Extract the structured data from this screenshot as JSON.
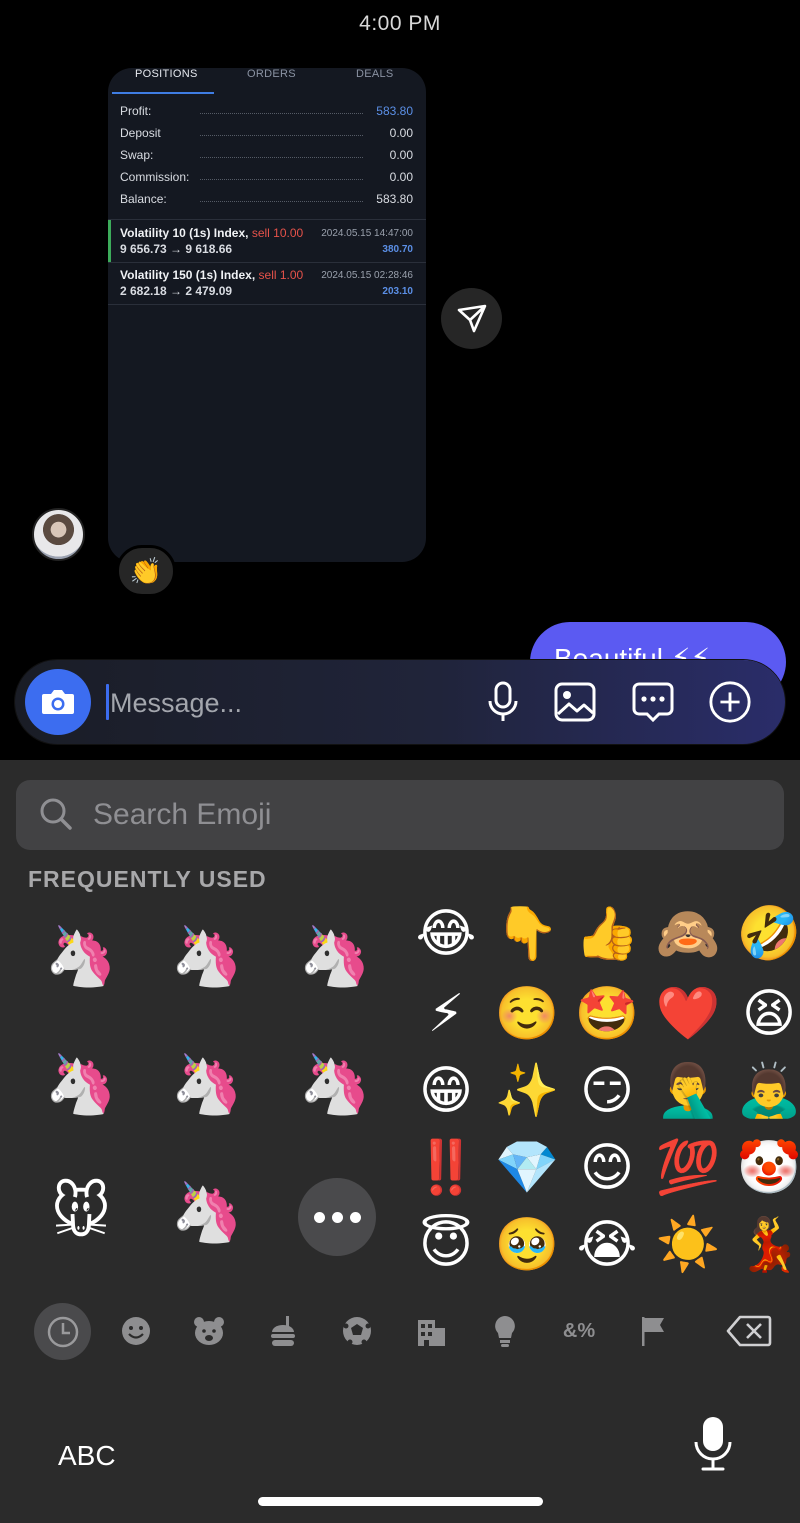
{
  "status": {
    "time": "4:00 PM"
  },
  "shared_card": {
    "tabs": [
      "POSITIONS",
      "ORDERS",
      "DEALS"
    ],
    "summary": [
      {
        "label": "Profit:",
        "value": "583.80"
      },
      {
        "label": "Deposit",
        "value": "0.00"
      },
      {
        "label": "Swap:",
        "value": "0.00"
      },
      {
        "label": "Commission:",
        "value": "0.00"
      },
      {
        "label": "Balance:",
        "value": "583.80"
      }
    ],
    "deals": [
      {
        "name": "Volatility 10 (1s) Index,",
        "side": "sell 10.00",
        "prices": "9 656.73 → 9 618.66",
        "date": "2024.05.15 14:47:00",
        "amount": "380.70"
      },
      {
        "name": "Volatility 150 (1s) Index,",
        "side": "sell 1.00",
        "prices": "2 682.18 → 2 479.09",
        "date": "2024.05.15 02:28:46",
        "amount": "203.10"
      }
    ]
  },
  "reaction": "👏",
  "outgoing_message": "Beautiful ⚡⚡",
  "composer": {
    "placeholder": "Message..."
  },
  "emoji_keyboard": {
    "search_placeholder": "Search Emoji",
    "section_title": "FREQUENTLY USED",
    "memojis": [
      "🦄",
      "🦄",
      "🦄",
      "🦄",
      "🦄",
      "🦄",
      "🐭",
      "🦄"
    ],
    "emojis": [
      [
        "😂",
        "👇",
        "👍",
        "🙈",
        "🤣"
      ],
      [
        "⚡",
        "☺️",
        "🤩",
        "❤️",
        "😫"
      ],
      [
        "😁",
        "✨",
        "😏",
        "🤦‍♂️",
        "🙇‍♂️"
      ],
      [
        "‼️",
        "💎",
        "😊",
        "💯",
        "🤡"
      ],
      [
        "😇",
        "🥹",
        "😭",
        "☀️",
        "💃"
      ]
    ],
    "categories": [
      "🕘",
      "☻",
      "🐻",
      "🍔",
      "⚽",
      "🏢",
      "💡",
      "&%",
      "⚑"
    ],
    "abc_label": "ABC"
  },
  "colors": {
    "accent": "#3c6df0",
    "bubble": "#5b5af2",
    "profit_blue": "#5b8fe6",
    "sell_red": "#e5524a"
  }
}
